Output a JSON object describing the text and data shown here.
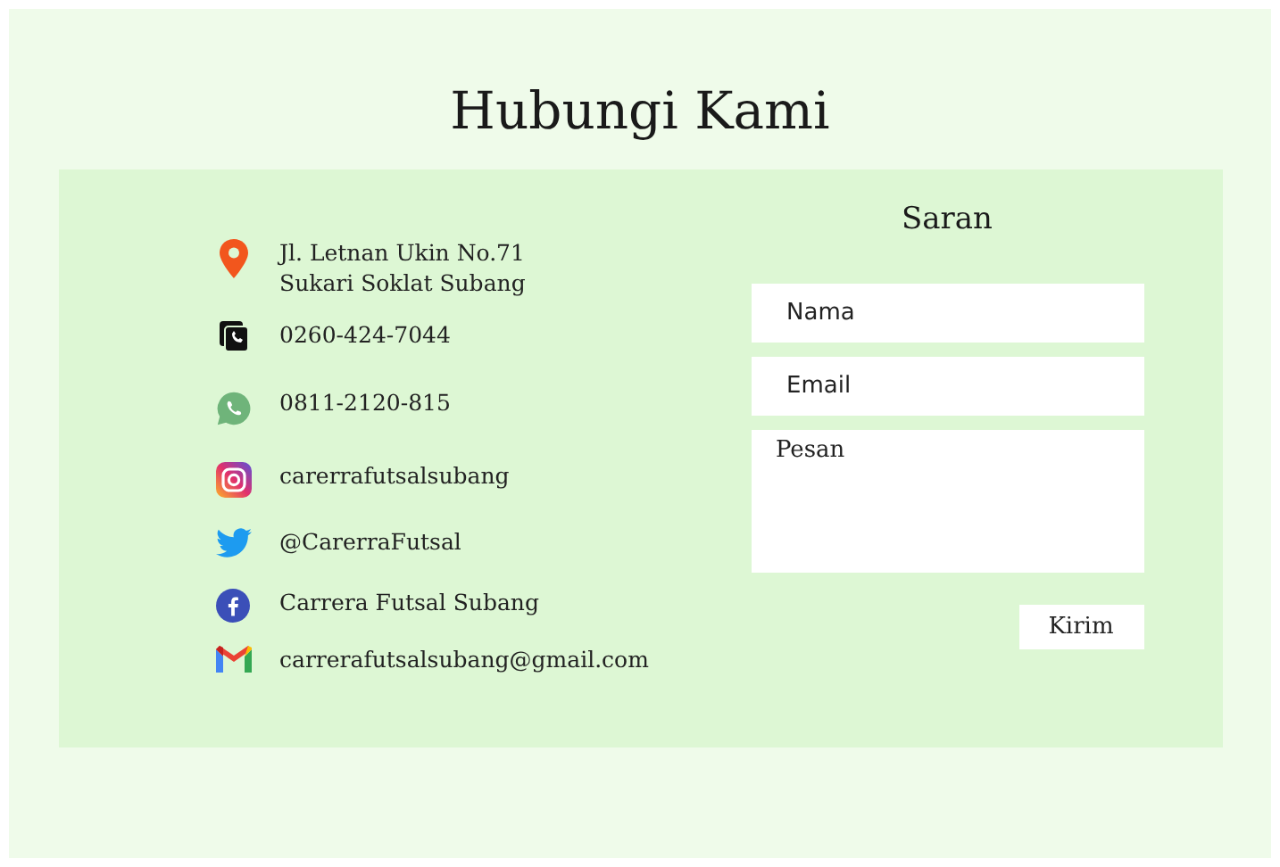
{
  "title": "Hubungi Kami",
  "contacts": [
    {
      "kind": "location",
      "lines": [
        "Jl. Letnan Ukin No.71",
        "Sukari Soklat Subang"
      ]
    },
    {
      "kind": "phone",
      "lines": [
        "0260-424-7044"
      ]
    },
    {
      "kind": "whatsapp",
      "lines": [
        "0811-2120-815"
      ]
    },
    {
      "kind": "instagram",
      "lines": [
        "carerrafutsalsubang"
      ]
    },
    {
      "kind": "twitter",
      "lines": [
        "@CarerraFutsal"
      ]
    },
    {
      "kind": "facebook",
      "lines": [
        "Carrera Futsal Subang"
      ]
    },
    {
      "kind": "gmail",
      "lines": [
        "carrerafutsalsubang@gmail.com"
      ]
    }
  ],
  "form": {
    "title": "Saran",
    "fields": [
      {
        "kind": "text",
        "placeholder": "Nama"
      },
      {
        "kind": "text",
        "placeholder": "Email"
      },
      {
        "kind": "textarea",
        "placeholder": "Pesan"
      }
    ],
    "submit": "Kirim"
  }
}
